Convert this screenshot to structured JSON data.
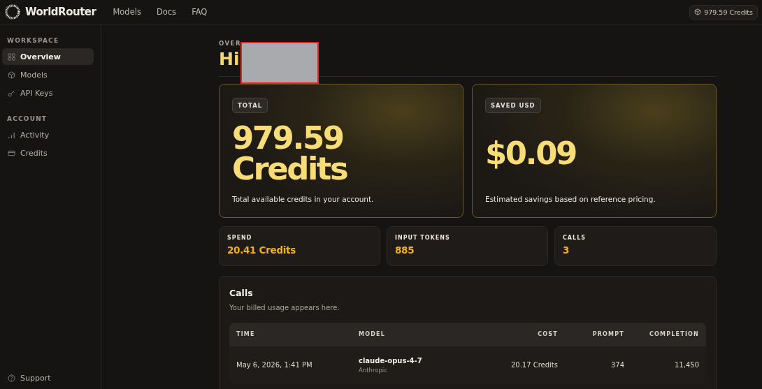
{
  "brand": {
    "name": "WorldRouter"
  },
  "nav": [
    "Models",
    "Docs",
    "FAQ"
  ],
  "credits_badge": "979.59 Credits",
  "sidebar": {
    "sections": [
      {
        "title": "WORKSPACE",
        "items": [
          {
            "label": "Overview",
            "selected": true
          },
          {
            "label": "Models",
            "selected": false
          },
          {
            "label": "API Keys",
            "selected": false
          }
        ]
      },
      {
        "title": "ACCOUNT",
        "items": [
          {
            "label": "Activity",
            "selected": false
          },
          {
            "label": "Credits",
            "selected": false
          }
        ]
      }
    ],
    "footer": "Support"
  },
  "page": {
    "eyebrow": "OVER",
    "greeting": "Hi",
    "redacted": true
  },
  "hero_cards": [
    {
      "tag": "TOTAL",
      "value": "979.59 Credits",
      "caption": "Total available credits in your account."
    },
    {
      "tag": "SAVED USD",
      "value": "$0.09",
      "caption": "Estimated savings based on reference pricing."
    }
  ],
  "stats": [
    {
      "label": "SPEND",
      "value": "20.41 Credits"
    },
    {
      "label": "INPUT TOKENS",
      "value": "885"
    },
    {
      "label": "CALLS",
      "value": "3"
    }
  ],
  "calls": {
    "title": "Calls",
    "subtitle": "Your billed usage appears here.",
    "columns": [
      "TIME",
      "MODEL",
      "COST",
      "PROMPT",
      "COMPLETION"
    ],
    "rows": [
      {
        "time": "May 6, 2026, 1:41 PM",
        "model": "claude-opus-4-7",
        "provider": "Anthropic",
        "cost": "20.17 Credits",
        "prompt": "374",
        "completion": "11,450"
      }
    ]
  }
}
